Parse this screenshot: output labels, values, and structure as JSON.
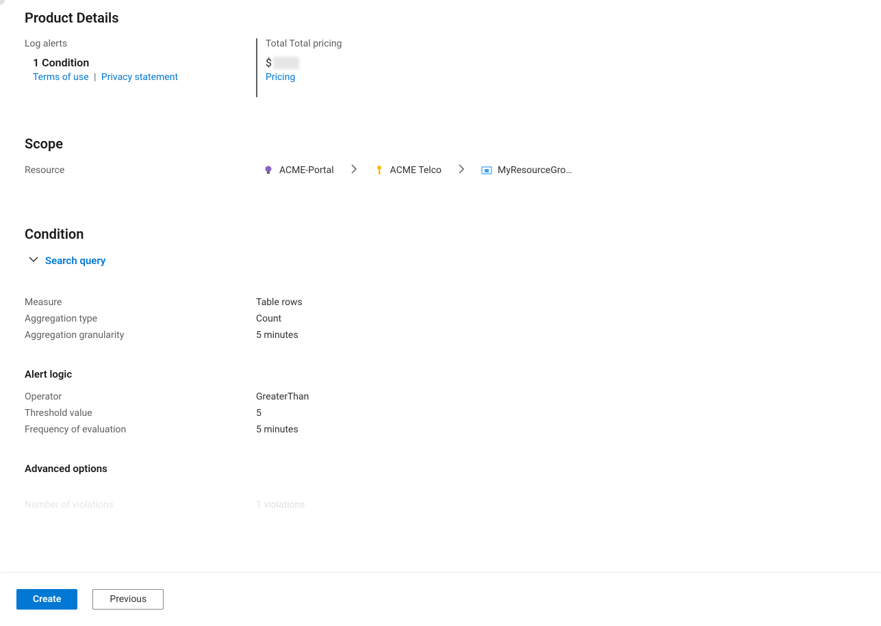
{
  "product_details": {
    "heading": "Product Details",
    "log_alerts_label": "Log alerts",
    "condition_count": "1 Condition",
    "terms_link": "Terms of use",
    "separator": "|",
    "privacy_link": "Privacy statement",
    "total_pricing_label": "Total Total pricing",
    "price_prefix": "$",
    "pricing_link": "Pricing"
  },
  "scope": {
    "heading": "Scope",
    "resource_label": "Resource",
    "breadcrumbs": [
      {
        "label": "ACME-Portal"
      },
      {
        "label": "ACME Telco"
      },
      {
        "label": "MyResourceGro…"
      }
    ]
  },
  "condition": {
    "heading": "Condition",
    "search_query": "Search query",
    "measure": {
      "key": "Measure",
      "val": "Table rows"
    },
    "aggregation_type": {
      "key": "Aggregation type",
      "val": "Count"
    },
    "aggregation_granularity": {
      "key": "Aggregation granularity",
      "val": "5 minutes"
    },
    "alert_logic_heading": "Alert logic",
    "operator": {
      "key": "Operator",
      "val": "GreaterThan"
    },
    "threshold": {
      "key": "Threshold value",
      "val": "5"
    },
    "frequency": {
      "key": "Frequency of evaluation",
      "val": "5 minutes"
    },
    "advanced_options_heading": "Advanced options",
    "num_violations": {
      "key": "Number of violations",
      "val": "1 violations"
    }
  },
  "footer": {
    "create": "Create",
    "previous": "Previous"
  }
}
